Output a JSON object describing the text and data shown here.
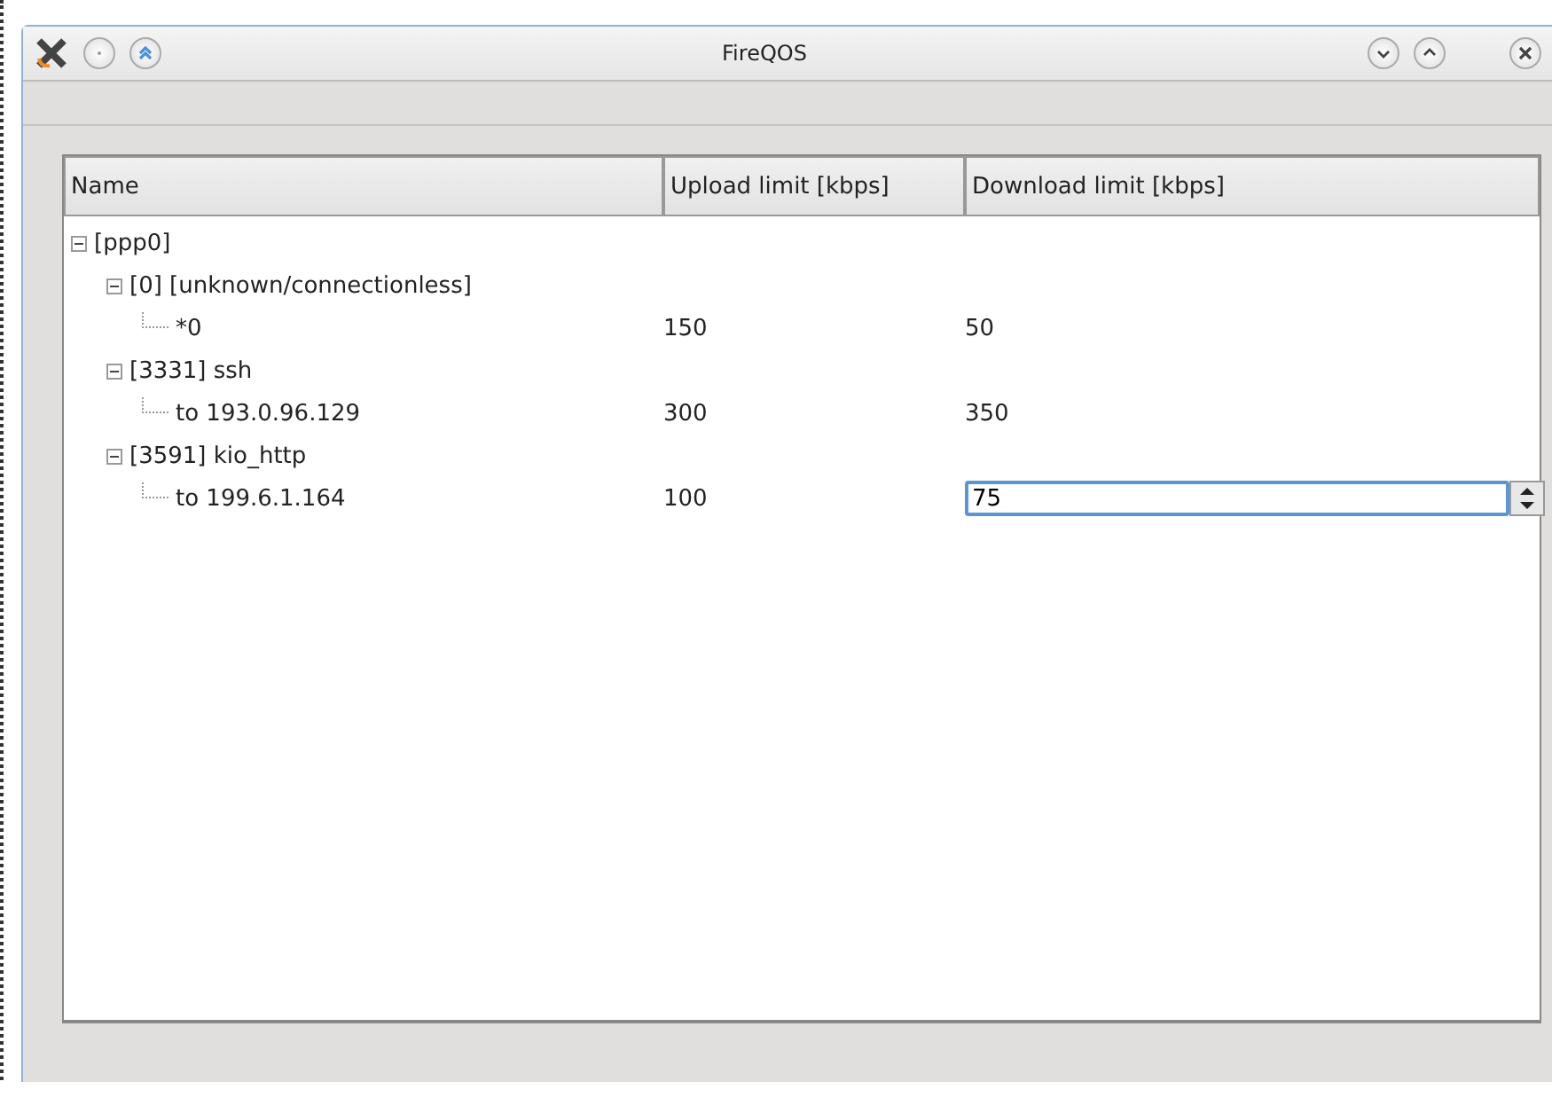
{
  "window": {
    "title": "FireQOS"
  },
  "columns": [
    "Name",
    "Upload limit [kbps]",
    "Download limit [kbps]"
  ],
  "tree": [
    {
      "name": "[ppp0]",
      "expanded": true,
      "children": [
        {
          "name": "[0] [unknown/connectionless]",
          "expanded": true,
          "children": [
            {
              "name": "*0",
              "upload": "150",
              "download": "50",
              "editing": false
            }
          ]
        },
        {
          "name": "[3331] ssh",
          "expanded": true,
          "children": [
            {
              "name": "to 193.0.96.129",
              "upload": "300",
              "download": "350",
              "editing": false
            }
          ]
        },
        {
          "name": "[3591] kio_http",
          "expanded": true,
          "children": [
            {
              "name": "to 199.6.1.164",
              "upload": "100",
              "download": "75",
              "editing": true
            }
          ]
        }
      ]
    }
  ]
}
